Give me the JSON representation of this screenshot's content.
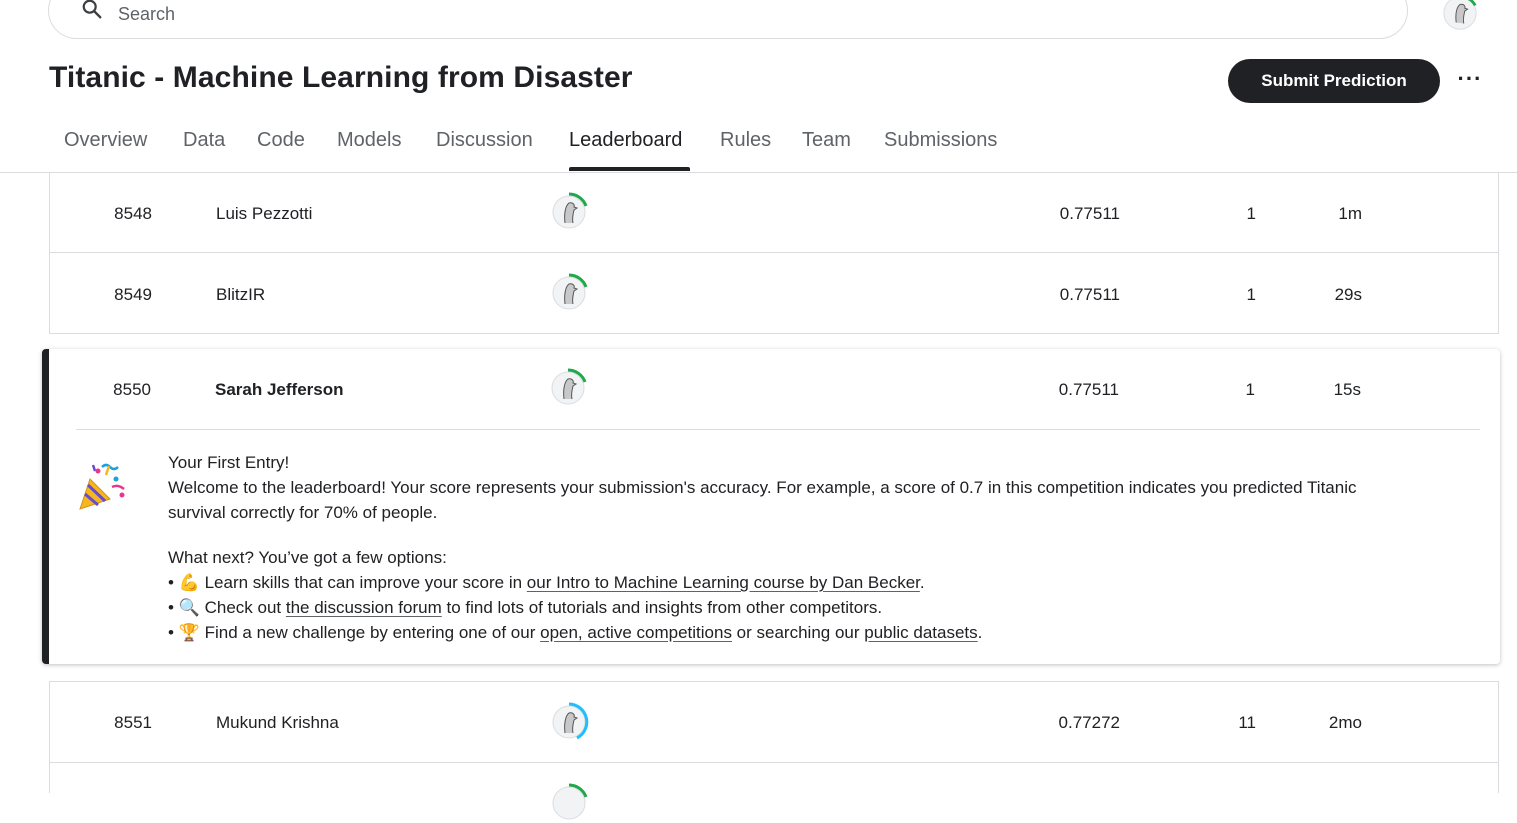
{
  "search": {
    "placeholder": "Search"
  },
  "competition": {
    "title": "Titanic - Machine Learning from Disaster"
  },
  "actions": {
    "submit_label": "Submit Prediction",
    "more_label": "···"
  },
  "tabs": [
    {
      "label": "Overview"
    },
    {
      "label": "Data"
    },
    {
      "label": "Code"
    },
    {
      "label": "Models"
    },
    {
      "label": "Discussion"
    },
    {
      "label": "Leaderboard",
      "active": true
    },
    {
      "label": "Rules"
    },
    {
      "label": "Team"
    },
    {
      "label": "Submissions"
    }
  ],
  "leaderboard": {
    "rows": [
      {
        "rank": "8548",
        "team": "Luis Pezzotti",
        "score": "0.77511",
        "entries": "1",
        "last": "1m"
      },
      {
        "rank": "8549",
        "team": "BlitzIR",
        "score": "0.77511",
        "entries": "1",
        "last": "29s"
      },
      {
        "rank": "8550",
        "team": "Sarah Jefferson",
        "score": "0.77511",
        "entries": "1",
        "last": "15s"
      },
      {
        "rank": "8551",
        "team": "Mukund Krishna",
        "score": "0.77272",
        "entries": "11",
        "last": "2mo"
      }
    ]
  },
  "first_entry": {
    "heading": "Your First Entry!",
    "line1": "Welcome to the leaderboard! Your score represents your submission's accuracy. For example, a score of 0.7 in this competition indicates you predicted Titanic",
    "line2": "survival correctly for 70% of people.",
    "next": "What next? You’ve got a few options:",
    "b1_pre": "Learn skills that can improve your score in ",
    "b1_link": "our Intro to Machine Learning course by Dan Becker",
    "b1_post": ".",
    "b2_pre": "Check out ",
    "b2_link": "the discussion forum",
    "b2_post": " to find lots of tutorials and insights from other competitors.",
    "b3_pre": "Find a new challenge by entering one of our ",
    "b3_link": "open, active competitions",
    "b3_mid": " or searching our ",
    "b3_link2": "public datasets",
    "b3_post": "."
  },
  "colors": {
    "accent_green": "#20BEFF",
    "progress_green": "#20a84a",
    "progress_blue": "#20beff",
    "dark": "#202124"
  },
  "icons": {
    "search": "search-icon",
    "party": "party-popper-icon",
    "muscle": "flexed-biceps-icon",
    "magnifier": "magnifying-glass-icon",
    "trophy": "trophy-icon"
  }
}
